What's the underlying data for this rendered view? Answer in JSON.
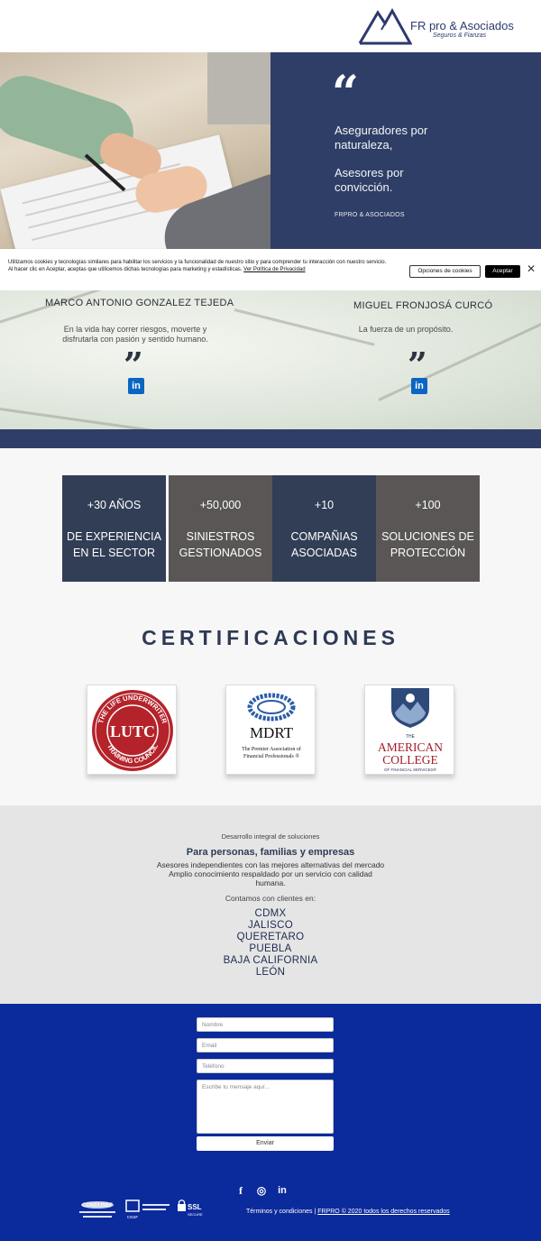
{
  "header": {
    "logo_name": "FR pro & Asociados",
    "logo_sub": "Seguros & Fianzas"
  },
  "hero": {
    "quote_mark": "“",
    "line1": "Aseguradores por",
    "line2": "naturaleza,",
    "line3": "Asesores por",
    "line4": "convicción.",
    "brand": "FRPRO & ASOCIADOS"
  },
  "cookie": {
    "text": "Utilizamos cookies y tecnologías similares para habilitar los servicios y la funcionalidad de nuestro sitio y para comprender tu interacción con nuestro servicio. Al hacer clic en Aceptar, aceptas que utilicemos dichas tecnologías para marketing y estadísticas.",
    "policy_link": "Ver Política de Privacidad",
    "options_label": "Opciones de cookies",
    "accept_label": "Aceptar",
    "close_label": "✕"
  },
  "team": {
    "member1": {
      "name": "MARCO ANTONIO GONZALEZ TEJEDA",
      "bio_line1": "En la  vida hay correr riesgos, moverte y",
      "bio_line2": "disfrutarla con pasión y sentido humano.",
      "quote_mark": "”",
      "linkedin": "in"
    },
    "member2": {
      "name": "MIGUEL FRONJOSÁ CURCÓ",
      "bio_line1": "La fuerza de un propósito.",
      "quote_mark": "”",
      "linkedin": "in"
    }
  },
  "stats": [
    {
      "value": "+30 AÑOS",
      "label_line1": "DE EXPERIENCIA",
      "label_line2": "EN EL SECTOR",
      "color": "#323e55"
    },
    {
      "value": "+50,000",
      "label_line1": "SINIESTROS",
      "label_line2": "GESTIONADOS",
      "color": "#5a5656"
    },
    {
      "value": "+10",
      "label_line1": "COMPAÑIAS",
      "label_line2": "ASOCIADAS",
      "color": "#323e55"
    },
    {
      "value": "+100",
      "label_line1": "SOLUCIONES DE",
      "label_line2": "PROTECCIÓN",
      "color": "#5a5656"
    }
  ],
  "certifications": {
    "title": "CERTIFICACIONES",
    "ltc": {
      "letters": "LUTC",
      "ring_top": "THE LIFE UNDERWRITER",
      "ring_bottom": "TRAINING COUNCIL"
    },
    "mdrt": {
      "name": "MDRT",
      "line1": "The Premier Association of",
      "line2": "Financial Professionals ®"
    },
    "tac": {
      "line1": "THE",
      "line2": "AMERICAN",
      "line3": "COLLEGE",
      "line4": "OF FINANCIAL SERVICES®"
    }
  },
  "info": {
    "tag": "Desarrollo integral de soluciones",
    "heading": "Para personas, familias y empresas",
    "desc_line1": "Asesores independientes con las mejores alternativas del mercado",
    "desc_line2": "Amplio conocimiento respaldado por un servicio con calidad",
    "desc_line3": "humana.",
    "clients_label": "Contamos con clientes en:",
    "cities": [
      "CDMX",
      "JALISCO",
      "QUERETARO",
      "PUEBLA",
      "BAJA CALIFORNIA",
      "LEÓN"
    ]
  },
  "contact": {
    "name_placeholder": "Nombre",
    "email_placeholder": "Email",
    "phone_placeholder": "Teléfono",
    "message_placeholder": "Escribe tu mensaje aquí...",
    "send_label": "Enviar"
  },
  "footer": {
    "social_facebook": "f",
    "social_instagram": "◎",
    "social_linkedin": "in",
    "badge_condusef": "CONDUSEF",
    "badge_cnsf": "CNSF",
    "badge_ssl": "SSL",
    "badge_ssl_sub": "SECURE",
    "terms": "Términos y condiciones",
    "separator": " | ",
    "copyright": "FRPRO © 2020 todos los derechos reservados"
  },
  "colors": {
    "navy": "#2f3e66",
    "stat_dark": "#323e55",
    "stat_gray": "#5a5656",
    "contact_blue": "#0b2a9b",
    "linkedin": "#0a66c2"
  }
}
